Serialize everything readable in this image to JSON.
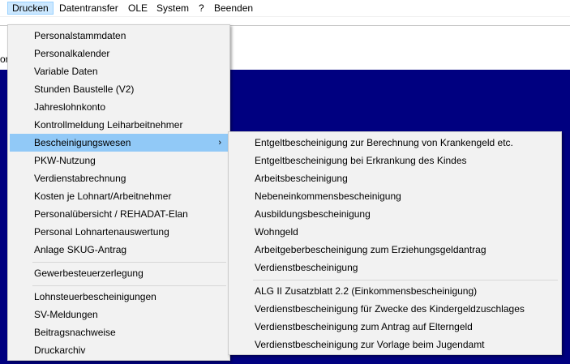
{
  "menubar": {
    "items": [
      "Drucken",
      "Datentransfer",
      "OLE",
      "System",
      "?",
      "Beenden"
    ]
  },
  "toolbar": {
    "fragment": "or"
  },
  "drucken_menu": {
    "items": [
      "Personalstammdaten",
      "Personalkalender",
      "Variable Daten",
      "Stunden Baustelle (V2)",
      "Jahreslohnkonto",
      "Kontrollmeldung Leiharbeitnehmer",
      "Bescheinigungswesen",
      "PKW-Nutzung",
      "Verdienstabrechnung",
      "Kosten je Lohnart/Arbeitnehmer",
      "Personalübersicht / REHADAT-Elan",
      "Personal Lohnartenauswertung",
      "Anlage SKUG-Antrag",
      "Gewerbesteuerzerlegung",
      "Lohnsteuerbescheinigungen",
      "SV-Meldungen",
      "Beitragsnachweise",
      "Druckarchiv"
    ],
    "submenu_arrow": "›"
  },
  "bescheinigungswesen_submenu": {
    "items": [
      "Entgeltbescheinigung zur Berechnung von Krankengeld etc.",
      "Entgeltbescheinigung bei Erkrankung des Kindes",
      "Arbeitsbescheinigung",
      "Nebeneinkommensbescheinigung",
      "Ausbildungsbescheinigung",
      "Wohngeld",
      "Arbeitgeberbescheinigung zum Erziehungsgeldantrag",
      "Verdienstbescheinigung",
      "ALG II Zusatzblatt 2.2 (Einkommensbescheinigung)",
      "Verdienstbescheinigung für Zwecke des Kindergeldzuschlages",
      "Verdienstbescheinigung zum Antrag auf Elterngeld",
      "Verdienstbescheinigung zur Vorlage beim Jugendamt"
    ]
  },
  "colors": {
    "workarea": "#000080",
    "highlight": "#91c9f7",
    "menubar_active": "#cce8ff"
  }
}
